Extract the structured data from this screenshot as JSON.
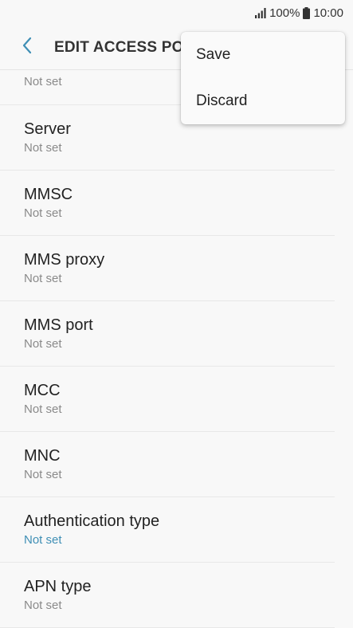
{
  "status_bar": {
    "battery": "100%",
    "time": "10:00",
    "icons": [
      "signal-icon",
      "battery-icon"
    ]
  },
  "header": {
    "title": "EDIT ACCESS POIN",
    "back_icon": "chevron-left-icon",
    "accent_color": "#3f8fb5"
  },
  "list": {
    "partial_value": "Not set",
    "items": [
      {
        "title": "Server",
        "value": "Not set"
      },
      {
        "title": "MMSC",
        "value": "Not set"
      },
      {
        "title": "MMS proxy",
        "value": "Not set"
      },
      {
        "title": "MMS port",
        "value": "Not set"
      },
      {
        "title": "MCC",
        "value": "Not set"
      },
      {
        "title": "MNC",
        "value": "Not set"
      },
      {
        "title": "Authentication type",
        "value": "Not set"
      },
      {
        "title": "APN type",
        "value": "Not set"
      }
    ]
  },
  "popup_menu": {
    "items": [
      {
        "label": "Save"
      },
      {
        "label": "Discard"
      }
    ]
  }
}
